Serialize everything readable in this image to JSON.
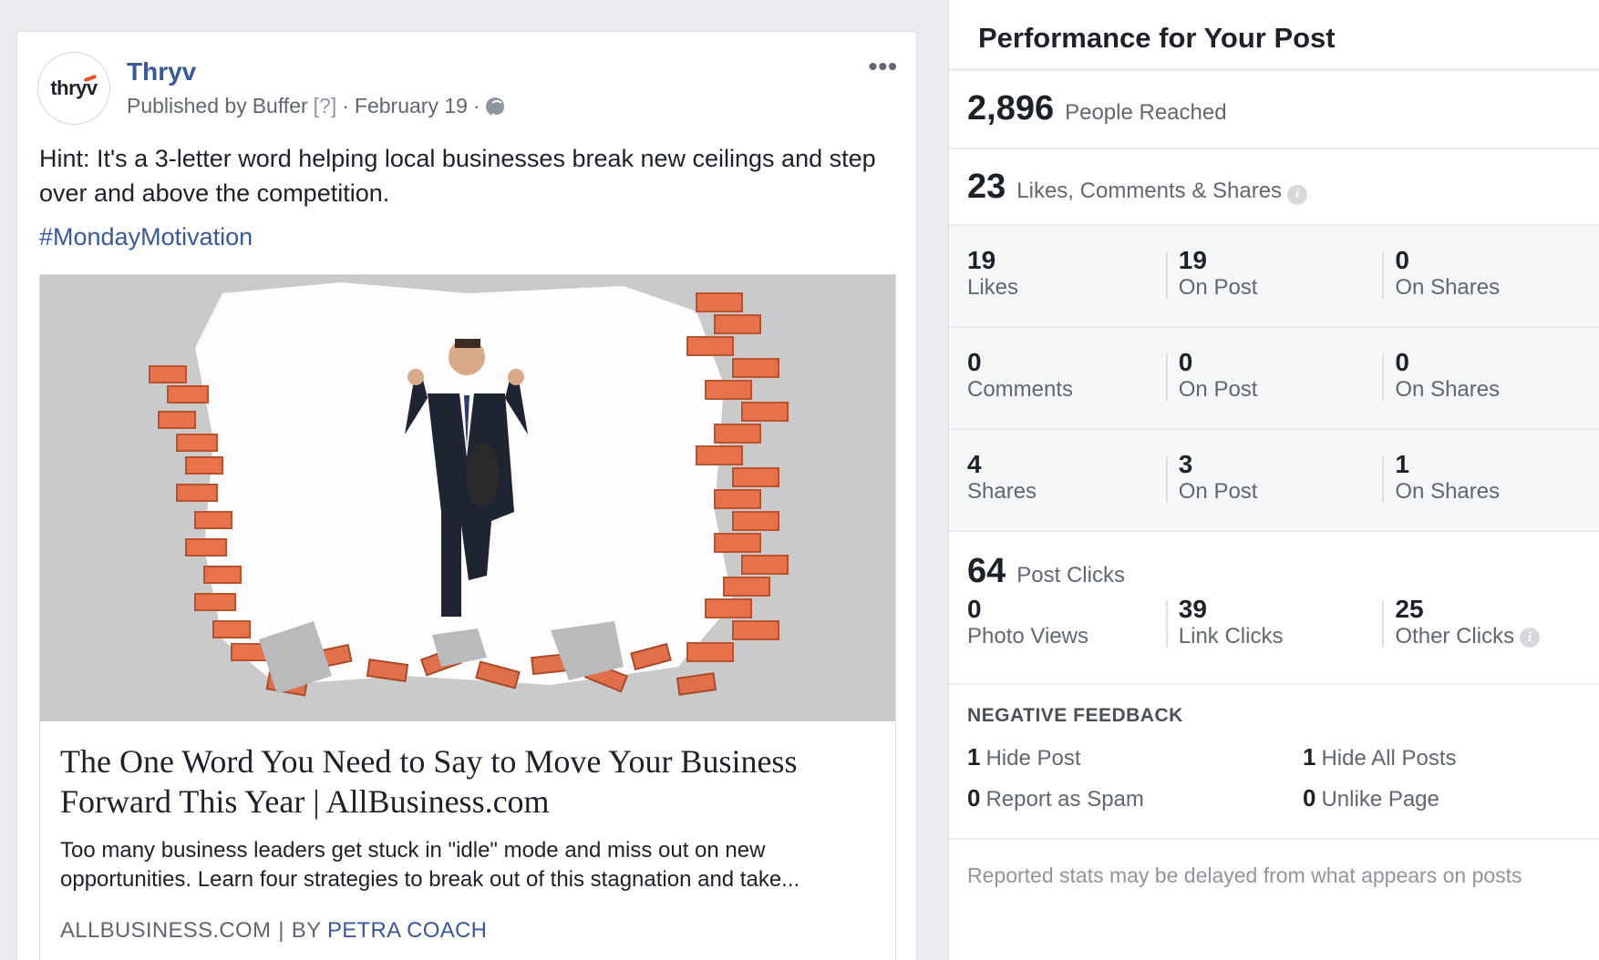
{
  "post": {
    "page_name": "Thryv",
    "avatar_text": "thryv",
    "published_by": "Published by",
    "publisher": "Buffer",
    "help_marker": "[?]",
    "separator": "·",
    "date": "February 19",
    "separator2": "·",
    "text": "Hint: It's a 3-letter word helping local businesses break new ceilings and step over and above the competition.",
    "hashtag": "#MondayMotivation",
    "link": {
      "title": "The One Word You Need to Say to Move Your Business Forward This Year | AllBusiness.com",
      "description": "Too many business leaders get stuck in \"idle\" mode and miss out on new opportunities. Learn four strategies to break out of this stagnation and take...",
      "domain": "ALLBUSINESS.COM",
      "divider": "|",
      "by": "BY",
      "author": "PETRA COACH"
    }
  },
  "performance": {
    "title": "Performance for Your Post",
    "reach": {
      "value": "2,896",
      "label": "People Reached"
    },
    "engagement": {
      "value": "23",
      "label": "Likes, Comments & Shares"
    },
    "rows": [
      [
        {
          "value": "19",
          "label": "Likes"
        },
        {
          "value": "19",
          "label": "On Post"
        },
        {
          "value": "0",
          "label": "On Shares"
        }
      ],
      [
        {
          "value": "0",
          "label": "Comments"
        },
        {
          "value": "0",
          "label": "On Post"
        },
        {
          "value": "0",
          "label": "On Shares"
        }
      ],
      [
        {
          "value": "4",
          "label": "Shares"
        },
        {
          "value": "3",
          "label": "On Post"
        },
        {
          "value": "1",
          "label": "On Shares"
        }
      ]
    ],
    "clicks": {
      "value": "64",
      "label": "Post Clicks",
      "items": [
        {
          "value": "0",
          "label": "Photo Views"
        },
        {
          "value": "39",
          "label": "Link Clicks"
        },
        {
          "value": "25",
          "label": "Other Clicks"
        }
      ]
    },
    "negative": {
      "title": "NEGATIVE FEEDBACK",
      "items": [
        {
          "value": "1",
          "label": "Hide Post"
        },
        {
          "value": "1",
          "label": "Hide All Posts"
        },
        {
          "value": "0",
          "label": "Report as Spam"
        },
        {
          "value": "0",
          "label": "Unlike Page"
        }
      ]
    },
    "note": "Reported stats may be delayed from what appears on posts"
  },
  "colors": {
    "link_blue": "#385898",
    "brick": "#e8734a",
    "page_bg": "#e9ebee"
  }
}
